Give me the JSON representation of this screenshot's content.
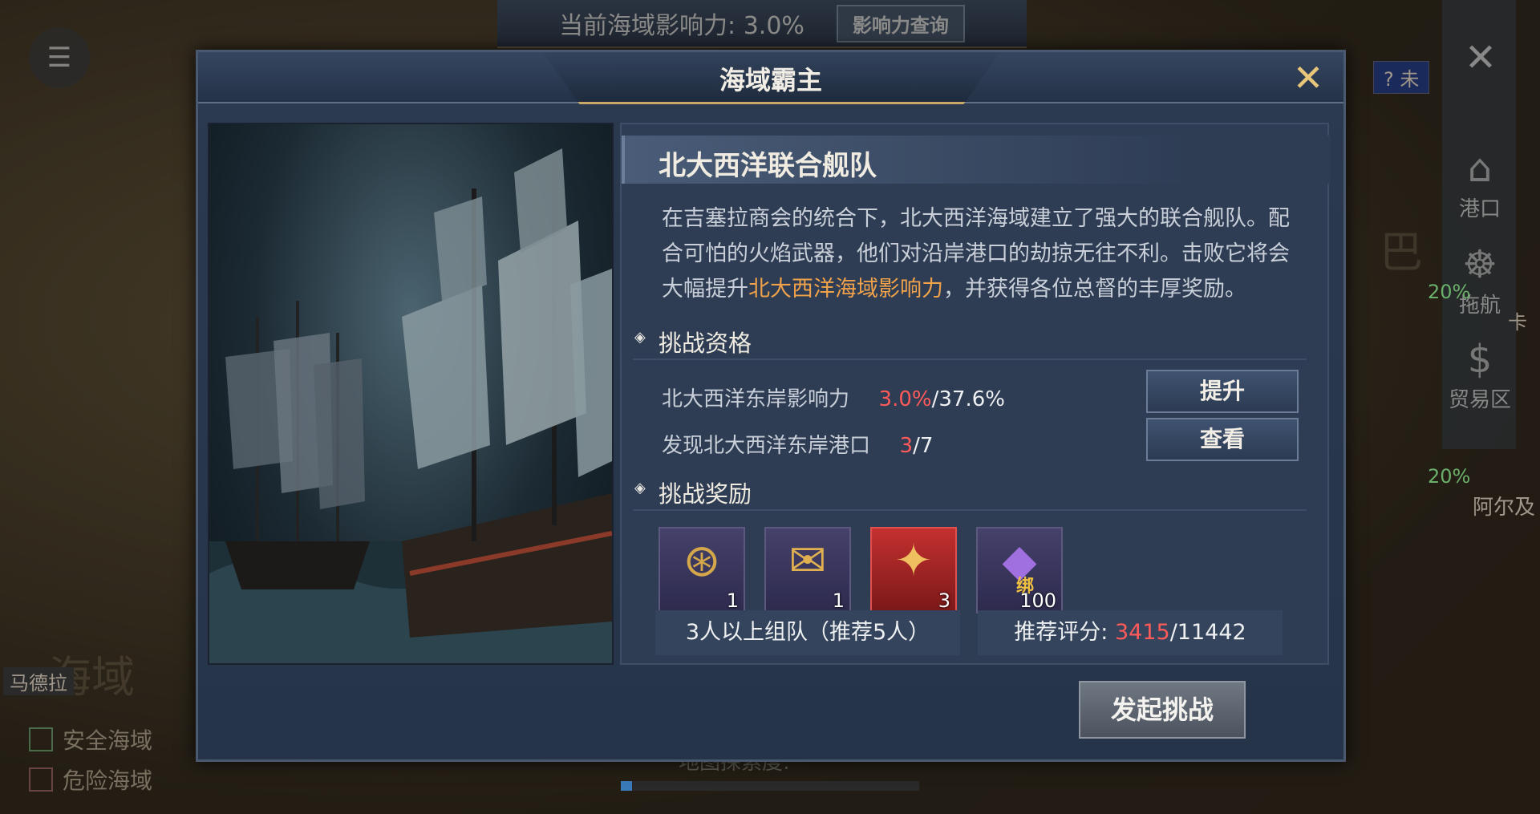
{
  "top_banner": {
    "influence_text": "当前海域影响力: 3.0%",
    "query_button": "影响力查询"
  },
  "map": {
    "sea_name": "海域",
    "region_name": "巴",
    "place_left": "马德拉",
    "place_right": "阿尔及",
    "tag_top": "未",
    "tag_mid": "卡",
    "legend": [
      {
        "label": "安全海域"
      },
      {
        "label": "危险海域"
      }
    ],
    "explore_label": "地图探索度:",
    "badges": [
      "20%",
      "20%"
    ]
  },
  "right_menu": [
    {
      "label": "港口",
      "icon": "harbor-icon"
    },
    {
      "label": "拖航",
      "icon": "ship-wheel-icon"
    },
    {
      "label": "贸易区",
      "icon": "money-bag-icon"
    }
  ],
  "modal": {
    "title": "海域霸主",
    "fleet_name": "北大西洋联合舰队",
    "desc_before": "在吉塞拉商会的统合下，北大西洋海域建立了强大的联合舰队。配合可怕的火焰武器，他们对沿岸港口的劫掠无往不利。击败它将会大幅提升",
    "desc_highlight": "北大西洋海域影响力",
    "desc_after": "，并获得各位总督的丰厚奖励。",
    "section_qualification": "挑战资格",
    "req1_label": "北大西洋东岸影响力",
    "req1_current": "3.0%",
    "req1_target": "/37.6%",
    "req1_button": "提升",
    "req2_label": "发现北大西洋东岸港口",
    "req2_current": "3",
    "req2_target": "/7",
    "req2_button": "查看",
    "section_rewards": "挑战奖励",
    "rewards": [
      {
        "icon": "compass-medal-icon",
        "qty": "1"
      },
      {
        "icon": "envelope-icon",
        "qty": "1"
      },
      {
        "icon": "scroll-icon",
        "qty": "3"
      },
      {
        "icon": "diamond-icon",
        "qty": "100",
        "bound_tag": "绑"
      }
    ],
    "team_text": "3人以上组队（推荐5人）",
    "score_label": "推荐评分: ",
    "score_current": "3415",
    "score_target": "/11442",
    "challenge_button": "发起挑战",
    "colors": {
      "highlight": "#f0a24a",
      "red": "#ff5a5a",
      "gold": "#e8c77a"
    }
  }
}
